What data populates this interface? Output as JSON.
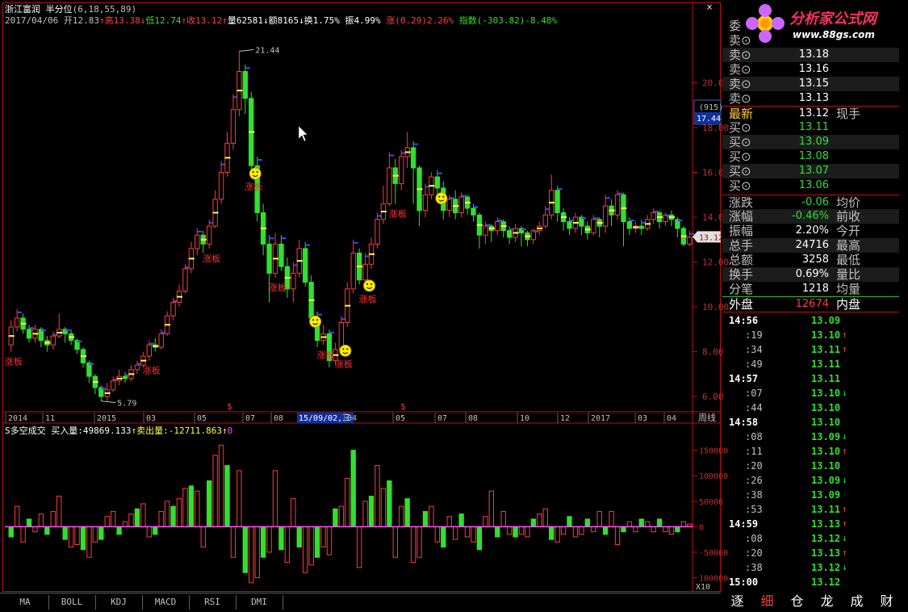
{
  "header": {
    "stock_name": "浙江富润",
    "indicator": "半分位",
    "indicator_params": "(6,18,55,89)",
    "date": "2017/04/06",
    "open_label": "开",
    "open": "12.83",
    "high_label": "高",
    "high": "13.38",
    "low_label": "低",
    "low": "12.74",
    "close_label": "收",
    "close": "13.12",
    "vol_label": "量",
    "vol": "62581",
    "amt_label": "额",
    "amt": "8165",
    "turnover_label": "换",
    "turnover": "1.75%",
    "amp_label": "振",
    "amp": "4.99%",
    "chg_label": "涨",
    "chg": "(0.29)2.26%",
    "index_label": "指数",
    "index": "(-303.82)-8.48%"
  },
  "close_icon": "×",
  "price_axis": {
    "ticks": [
      "20.00",
      "18.00",
      "16.00",
      "14.00",
      "12.00",
      "10.00",
      "8.00",
      "6.00"
    ],
    "tick_values": [
      20,
      18,
      16,
      14,
      12,
      10,
      8,
      6
    ],
    "box_top": "(915)",
    "box_bottom": "17.44",
    "current": "13.12",
    "hi_label": "21.44",
    "lo_label": "5.79"
  },
  "date_axis": {
    "labels": [
      "2014",
      "11",
      "2015",
      "03",
      "05",
      "07",
      "08",
      "15/09/02,三",
      "04",
      "05",
      "07",
      "08",
      "10",
      "12",
      "2017",
      "03",
      "04"
    ],
    "period": "周线"
  },
  "sub_header": {
    "name": "S多空成交",
    "buy_label": "买入量:",
    "buy": "49869.133",
    "sell_label": "卖出量:",
    "sell": "-12711.863",
    "zero": "0"
  },
  "vol_axis": {
    "ticks": [
      "150000",
      "100000",
      "50000",
      "0",
      "-50000",
      "100000"
    ],
    "tick_values": [
      150000,
      100000,
      50000,
      0,
      -50000,
      -100000
    ],
    "unit": "X10"
  },
  "markers": {
    "limit_up": "涨板",
    "dollar": "$"
  },
  "tabs": [
    "MA",
    "BOLL",
    "KDJ",
    "MACD",
    "RSI",
    "DMI"
  ],
  "logo": {
    "line1": "分析家公式网",
    "line2": "www.88gs.com"
  },
  "quote": {
    "commission_label": "委",
    "sell": [
      {
        "label": "卖",
        "price": ""
      },
      {
        "label": "卖",
        "price": "13.18"
      },
      {
        "label": "卖",
        "price": "13.16"
      },
      {
        "label": "卖",
        "price": "13.15"
      },
      {
        "label": "卖",
        "price": "13.13"
      }
    ],
    "latest_label": "最新",
    "latest": "13.12",
    "latest_extra": "现手",
    "buy": [
      {
        "label": "买",
        "price": "13.11"
      },
      {
        "label": "买",
        "price": "13.09"
      },
      {
        "label": "买",
        "price": "13.08"
      },
      {
        "label": "买",
        "price": "13.07"
      },
      {
        "label": "买",
        "price": "13.06"
      }
    ],
    "stats": [
      {
        "label": "涨跌",
        "value": "-0.06",
        "label2": "均价"
      },
      {
        "label": "涨幅",
        "value": "-0.46%",
        "label2": "前收"
      },
      {
        "label": "振幅",
        "value": "2.20%",
        "label2": "今开"
      },
      {
        "label": "总手",
        "value": "24716",
        "label2": "最高"
      },
      {
        "label": "总额",
        "value": "3258",
        "label2": "最低"
      },
      {
        "label": "换手",
        "value": "0.69%",
        "label2": "量比"
      },
      {
        "label": "分笔",
        "value": "1218",
        "label2": "均量"
      }
    ],
    "outer_label": "外盘",
    "outer": "12674",
    "inner_label": "内盘"
  },
  "ticks": [
    {
      "time": "14:56",
      "price": "13.09",
      "arrow": ""
    },
    {
      "time": ":19",
      "price": "13.10",
      "arrow": "↑"
    },
    {
      "time": ":34",
      "price": "13.11",
      "arrow": "↑"
    },
    {
      "time": ":49",
      "price": "13.11",
      "arrow": ""
    },
    {
      "time": "14:57",
      "price": "13.11",
      "arrow": ""
    },
    {
      "time": ":07",
      "price": "13.10",
      "arrow": "↓"
    },
    {
      "time": ":44",
      "price": "13.10",
      "arrow": ""
    },
    {
      "time": "14:58",
      "price": "13.10",
      "arrow": ""
    },
    {
      "time": ":08",
      "price": "13.09",
      "arrow": "↓"
    },
    {
      "time": ":11",
      "price": "13.10",
      "arrow": "↑"
    },
    {
      "time": ":20",
      "price": "13.10",
      "arrow": ""
    },
    {
      "time": ":26",
      "price": "13.09",
      "arrow": "↓"
    },
    {
      "time": ":38",
      "price": "13.09",
      "arrow": ""
    },
    {
      "time": ":53",
      "price": "13.11",
      "arrow": "↑"
    },
    {
      "time": "14:59",
      "price": "13.13",
      "arrow": "↑"
    },
    {
      "time": ":08",
      "price": "13.12",
      "arrow": "↓"
    },
    {
      "time": ":20",
      "price": "13.13",
      "arrow": "↑"
    },
    {
      "time": ":38",
      "price": "13.12",
      "arrow": "↓"
    },
    {
      "time": "15:00",
      "price": "13.12",
      "arrow": ""
    }
  ],
  "bottom_nav": [
    "逐",
    "细",
    "仓",
    "龙",
    "成",
    "财"
  ],
  "colors": {
    "up": "#ff3c3c",
    "down": "#30e030",
    "frame": "#c01010",
    "accent": "#ffff40"
  },
  "chart_data": {
    "type": "candlestick",
    "period": "weekly",
    "ylim": [
      5.5,
      22.5
    ],
    "candles": [
      [
        8.3,
        9.1,
        9.4,
        8.0
      ],
      [
        9.1,
        9.5,
        9.9,
        8.9
      ],
      [
        9.5,
        9.0,
        9.7,
        8.8
      ],
      [
        9.0,
        8.6,
        9.2,
        8.4
      ],
      [
        8.6,
        9.0,
        9.2,
        8.4
      ],
      [
        9.0,
        8.5,
        9.1,
        8.2
      ],
      [
        8.5,
        8.3,
        8.7,
        8.0
      ],
      [
        8.3,
        8.7,
        8.9,
        8.1
      ],
      [
        8.7,
        9.0,
        9.7,
        8.6
      ],
      [
        9.0,
        8.8,
        9.1,
        8.4
      ],
      [
        8.8,
        8.5,
        9.0,
        8.3
      ],
      [
        8.5,
        8.1,
        8.6,
        7.9
      ],
      [
        8.1,
        7.5,
        8.2,
        7.3
      ],
      [
        7.5,
        6.9,
        7.6,
        6.6
      ],
      [
        6.9,
        6.4,
        7.0,
        6.1
      ],
      [
        6.4,
        6.0,
        6.5,
        5.8
      ],
      [
        6.0,
        6.3,
        6.6,
        5.8
      ],
      [
        6.3,
        6.7,
        6.9,
        6.2
      ],
      [
        6.7,
        6.9,
        7.2,
        6.5
      ],
      [
        6.9,
        6.8,
        7.1,
        6.6
      ],
      [
        6.8,
        7.2,
        7.4,
        6.7
      ],
      [
        7.2,
        7.4,
        7.6,
        7.0
      ],
      [
        7.4,
        7.8,
        8.0,
        7.3
      ],
      [
        7.8,
        8.3,
        8.5,
        7.6
      ],
      [
        8.3,
        8.2,
        8.6,
        8.0
      ],
      [
        8.2,
        8.8,
        9.0,
        8.1
      ],
      [
        8.8,
        9.6,
        9.8,
        8.7
      ],
      [
        9.6,
        10.2,
        10.4,
        9.4
      ],
      [
        10.2,
        10.7,
        11.0,
        10.0
      ],
      [
        10.7,
        11.7,
        11.9,
        10.6
      ],
      [
        11.7,
        12.6,
        12.9,
        11.5
      ],
      [
        12.6,
        13.2,
        13.5,
        12.3
      ],
      [
        13.2,
        12.8,
        13.4,
        12.4
      ],
      [
        12.8,
        13.6,
        13.9,
        12.6
      ],
      [
        13.6,
        14.8,
        15.2,
        13.5
      ],
      [
        14.8,
        16.0,
        16.5,
        14.6
      ],
      [
        16.0,
        17.3,
        17.8,
        15.8
      ],
      [
        17.3,
        18.8,
        19.5,
        17.0
      ],
      [
        18.8,
        20.5,
        21.4,
        18.5
      ],
      [
        20.5,
        19.3,
        20.8,
        18.6
      ],
      [
        19.3,
        16.3,
        19.6,
        15.8
      ],
      [
        16.3,
        14.2,
        16.7,
        13.8
      ],
      [
        14.2,
        12.8,
        14.6,
        12.3
      ],
      [
        12.8,
        11.5,
        13.2,
        10.2
      ],
      [
        11.5,
        12.8,
        13.3,
        11.3
      ],
      [
        12.8,
        11.8,
        13.2,
        11.6
      ],
      [
        11.8,
        10.8,
        12.2,
        10.4
      ],
      [
        10.8,
        11.5,
        12.0,
        10.2
      ],
      [
        11.5,
        12.6,
        13.0,
        11.3
      ],
      [
        12.6,
        11.1,
        12.9,
        10.9
      ],
      [
        11.1,
        9.5,
        11.4,
        9.2
      ],
      [
        9.5,
        8.5,
        9.8,
        8.2
      ],
      [
        8.5,
        8.8,
        9.2,
        8.3
      ],
      [
        8.8,
        7.6,
        9.0,
        7.3
      ],
      [
        7.6,
        8.1,
        8.4,
        7.4
      ],
      [
        8.1,
        9.3,
        9.6,
        7.9
      ],
      [
        9.3,
        10.8,
        11.1,
        9.1
      ],
      [
        10.8,
        12.4,
        13.0,
        10.6
      ],
      [
        12.4,
        11.2,
        12.6,
        11.0
      ],
      [
        11.2,
        11.9,
        12.4,
        10.8
      ],
      [
        11.9,
        12.8,
        13.1,
        11.7
      ],
      [
        12.8,
        13.9,
        14.2,
        12.6
      ],
      [
        13.9,
        14.6,
        15.4,
        13.7
      ],
      [
        14.6,
        16.2,
        16.9,
        14.5
      ],
      [
        16.2,
        15.5,
        16.6,
        14.6
      ],
      [
        15.5,
        16.7,
        17.0,
        15.2
      ],
      [
        16.7,
        17.1,
        17.8,
        16.2
      ],
      [
        17.1,
        16.2,
        17.4,
        14.6
      ],
      [
        16.2,
        14.3,
        16.3,
        13.6
      ],
      [
        14.3,
        15.0,
        15.5,
        14.0
      ],
      [
        15.0,
        15.8,
        16.0,
        14.8
      ],
      [
        15.8,
        15.3,
        16.1,
        14.7
      ],
      [
        15.3,
        14.3,
        15.6,
        13.9
      ],
      [
        14.3,
        14.8,
        15.0,
        14.0
      ],
      [
        14.8,
        14.2,
        15.2,
        13.9
      ],
      [
        14.2,
        14.9,
        15.1,
        14.0
      ],
      [
        14.9,
        14.4,
        15.0,
        14.1
      ],
      [
        14.4,
        14.1,
        14.6,
        13.8
      ],
      [
        14.1,
        13.2,
        14.2,
        12.6
      ],
      [
        13.2,
        13.6,
        13.8,
        12.8
      ],
      [
        13.6,
        13.4,
        13.7,
        12.9
      ],
      [
        13.4,
        13.8,
        14.0,
        13.2
      ],
      [
        13.8,
        13.4,
        13.9,
        13.1
      ],
      [
        13.4,
        13.1,
        13.6,
        12.8
      ],
      [
        13.1,
        13.5,
        13.7,
        12.9
      ],
      [
        13.5,
        13.3,
        13.6,
        12.7
      ],
      [
        13.3,
        13.0,
        13.4,
        12.7
      ],
      [
        13.0,
        13.4,
        13.5,
        12.8
      ],
      [
        13.4,
        13.6,
        13.8,
        13.2
      ],
      [
        13.6,
        14.1,
        14.5,
        13.5
      ],
      [
        14.1,
        15.2,
        15.9,
        13.9
      ],
      [
        15.2,
        14.2,
        15.4,
        13.8
      ],
      [
        14.2,
        13.8,
        14.4,
        13.4
      ],
      [
        13.8,
        13.5,
        14.0,
        13.2
      ],
      [
        13.5,
        14.0,
        14.2,
        13.3
      ],
      [
        14.0,
        13.6,
        14.1,
        13.2
      ],
      [
        13.6,
        13.3,
        13.8,
        13.0
      ],
      [
        13.3,
        13.9,
        14.1,
        13.2
      ],
      [
        13.9,
        13.6,
        14.0,
        13.1
      ],
      [
        13.6,
        14.5,
        15.0,
        13.3
      ],
      [
        14.5,
        14.1,
        14.8,
        13.6
      ],
      [
        14.1,
        15.0,
        15.2,
        13.9
      ],
      [
        15.0,
        13.8,
        15.1,
        12.7
      ],
      [
        13.8,
        13.5,
        14.0,
        13.2
      ],
      [
        13.5,
        13.6,
        13.8,
        13.3
      ],
      [
        13.6,
        13.5,
        13.9,
        13.2
      ],
      [
        13.5,
        13.9,
        14.1,
        13.4
      ],
      [
        13.9,
        14.2,
        14.4,
        13.7
      ],
      [
        14.2,
        13.8,
        14.3,
        13.5
      ],
      [
        13.8,
        14.1,
        14.2,
        13.6
      ],
      [
        14.1,
        13.9,
        14.3,
        13.6
      ],
      [
        13.9,
        13.5,
        14.0,
        13.1
      ],
      [
        13.5,
        12.8,
        13.6,
        12.7
      ],
      [
        12.8,
        13.1,
        13.4,
        12.7
      ]
    ],
    "volume": [
      -20000,
      40000,
      -30000,
      15000,
      -10000,
      25000,
      -15000,
      30000,
      60000,
      -25000,
      -40000,
      -35000,
      -45000,
      -60000,
      -30000,
      -25000,
      20000,
      30000,
      -15000,
      10000,
      25000,
      35000,
      45000,
      -20000,
      -15000,
      30000,
      50000,
      40000,
      55000,
      75000,
      80000,
      70000,
      -40000,
      90000,
      140000,
      160000,
      120000,
      -60000,
      110000,
      -90000,
      -110000,
      -100000,
      -60000,
      -50000,
      110000,
      -45000,
      -70000,
      55000,
      -40000,
      -90000,
      -75000,
      -60000,
      -40000,
      -55000,
      35000,
      40000,
      95000,
      150000,
      -80000,
      50000,
      60000,
      120000,
      75000,
      90000,
      -60000,
      40000,
      55000,
      -70000,
      -60000,
      30000,
      40000,
      -30000,
      -40000,
      20000,
      -25000,
      25000,
      -20000,
      -30000,
      -45000,
      20000,
      70000,
      -20000,
      30000,
      -15000,
      -20000,
      -15000,
      -20000,
      15000,
      25000,
      35000,
      -25000,
      -30000,
      -15000,
      20000,
      -20000,
      -15000,
      15000,
      -10000,
      30000,
      -15000,
      30000,
      -35000,
      -10000,
      10000,
      -10000,
      15000,
      10000,
      -10000,
      15000,
      -10000,
      -15000,
      -10000,
      10000,
      5000
    ]
  }
}
